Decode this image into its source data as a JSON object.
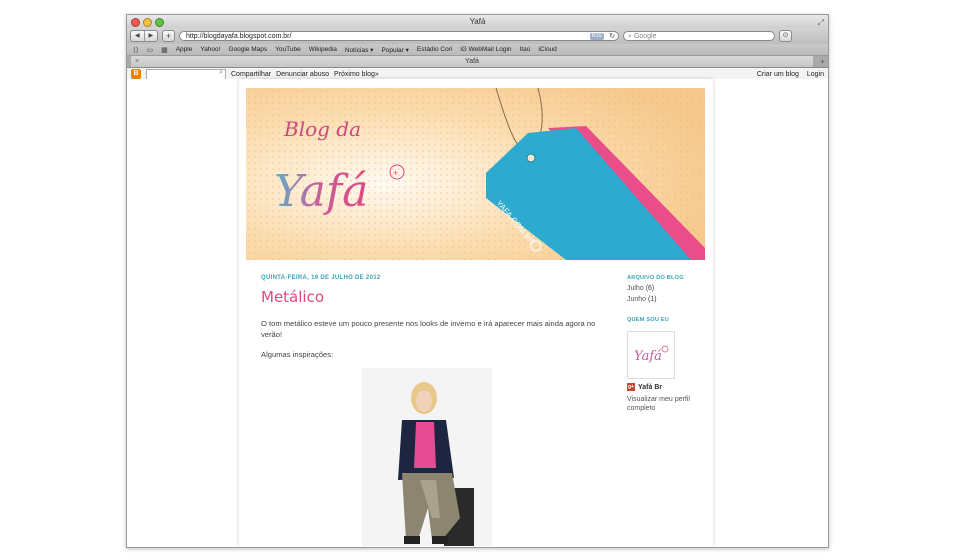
{
  "window": {
    "title": "Yafá"
  },
  "toolbar": {
    "url": "http://blogdayafa.blogspot.com.br/",
    "rss": "RSS",
    "search_placeholder": "Google"
  },
  "bookmarks": [
    "Apple",
    "Yahoo!",
    "Google Maps",
    "YouTube",
    "Wikipedia",
    "Notícias ▾",
    "Popular ▾",
    "Estádio Cori",
    "iG WebMail Login",
    "Itaú",
    "iCloud"
  ],
  "tab": {
    "title": "Yafá"
  },
  "blogger_nav": {
    "share": "Compartilhar",
    "report": "Denunciar abuso",
    "next": "Próximo blog»",
    "create": "Criar um blog",
    "login": "Login"
  },
  "header": {
    "title_line1": "Blog da",
    "title_line2": "Yafá",
    "tag_text": "YAFA.COM.BR"
  },
  "post": {
    "date": "QUINTA-FEIRA, 19 DE JULHO DE 2012",
    "title": "Metálico",
    "paragraph1": "O tom metálico esteve um pouco presente nos looks de inverno e irá aparecer mais ainda agora no verão!",
    "paragraph2": "Algumas inspirações:"
  },
  "sidebar": {
    "archive_title": "ARQUIVO DO BLOG",
    "archive": [
      {
        "month": "Julho",
        "count": "(6)"
      },
      {
        "month": "Junho",
        "count": "(1)"
      }
    ],
    "about_title": "QUEM SOU EU",
    "profile_logo": "Yafá",
    "profile_name": "Yafá Br",
    "profile_link": "Visualizar meu perfil completo"
  },
  "colors": {
    "accent_pink": "#e0487f",
    "accent_teal": "#3aa2b8",
    "banner_orange": "#f6c98d"
  }
}
